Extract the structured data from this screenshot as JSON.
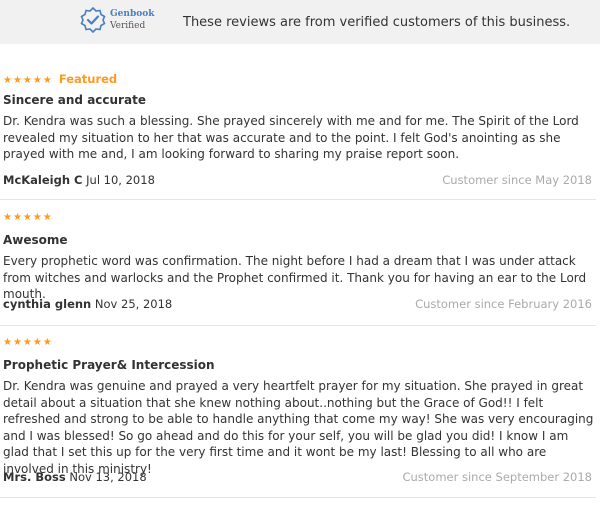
{
  "banner": {
    "badge_name": "Genbook",
    "badge_sub": "Verified",
    "text": "These reviews are from verified customers of this business."
  },
  "reviews": [
    {
      "stars": "★★★★★",
      "featured": "Featured",
      "title": "Sincere and accurate",
      "body": "Dr. Kendra was such a blessing. She prayed sincerely with me and for me. The Spirit of the Lord revealed my situation to her that was accurate and to the point. I felt God's anointing as she prayed with me and, I am looking forward to sharing my praise report soon.",
      "author": "McKaleigh C",
      "date": "Jul 10, 2018",
      "since": "Customer since May 2018"
    },
    {
      "stars": "★★★★★",
      "title": "Awesome",
      "body": "Every prophetic word was confirmation. The night before I had a dream that I was under attack from witches and warlocks and the Prophet confirmed it. Thank you for having an ear to the Lord mouth.",
      "author": "cynthia glenn",
      "date": "Nov 25, 2018",
      "since": "Customer since February 2016"
    },
    {
      "stars": "★★★★★",
      "title": "Prophetic Prayer& Intercession",
      "body": "Dr. Kendra was genuine and prayed a very heartfelt prayer for my situation. She prayed in great detail about a situation that she knew nothing about..nothing but the Grace of God!! I felt refreshed and strong to be able to handle anything that come my way! She was very encouraging and I was blessed! So go ahead and do this for your self, you will be glad you did! I know I am glad that I set this up for the very first time and it wont be my last! Blessing to all who are involved in this ministry!",
      "author": "Mrs. Boss",
      "date": "Nov 13, 2018",
      "since": "Customer since September 2018"
    }
  ]
}
